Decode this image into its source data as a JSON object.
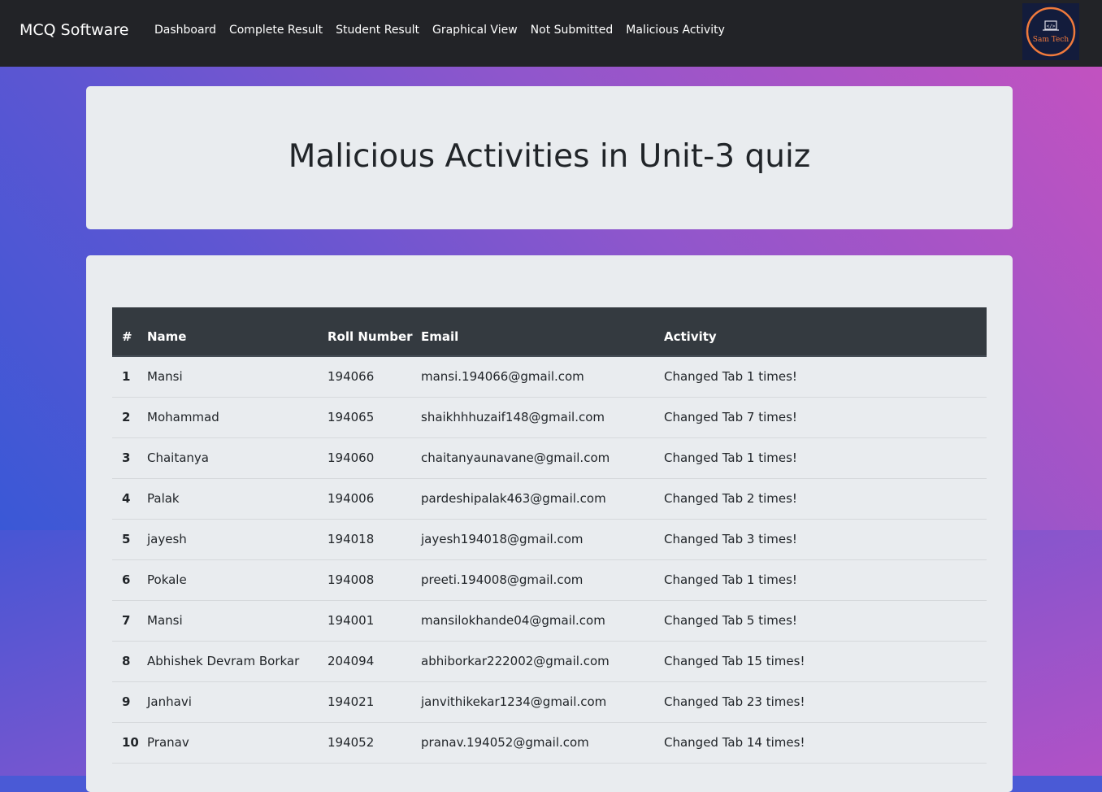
{
  "navbar": {
    "brand": "MCQ Software",
    "links": [
      "Dashboard",
      "Complete Result",
      "Student Result",
      "Graphical View",
      "Not Submitted",
      "Malicious Activity"
    ],
    "logo_text": "Sam Tech"
  },
  "page_title": "Malicious Activities in Unit-3 quiz",
  "table": {
    "headers": [
      "#",
      "Name",
      "Roll Number",
      "Email",
      "Activity"
    ],
    "rows": [
      [
        "1",
        "Mansi",
        "194066",
        "mansi.194066@gmail.com",
        "Changed Tab 1 times!"
      ],
      [
        "2",
        "Mohammad",
        "194065",
        "shaikhhhuzaif148@gmail.com",
        "Changed Tab 7 times!"
      ],
      [
        "3",
        "Chaitanya",
        "194060",
        "chaitanyaunavane@gmail.com",
        "Changed Tab 1 times!"
      ],
      [
        "4",
        "Palak",
        "194006",
        "pardeshipalak463@gmail.com",
        "Changed Tab 2 times!"
      ],
      [
        "5",
        "jayesh",
        "194018",
        "jayesh194018@gmail.com",
        "Changed Tab 3 times!"
      ],
      [
        "6",
        "Pokale",
        "194008",
        "preeti.194008@gmail.com",
        "Changed Tab 1 times!"
      ],
      [
        "7",
        "Mansi",
        "194001",
        "mansilokhande04@gmail.com",
        "Changed Tab 5 times!"
      ],
      [
        "8",
        "Abhishek Devram Borkar",
        "204094",
        "abhiborkar222002@gmail.com",
        "Changed Tab 15 times!"
      ],
      [
        "9",
        "Janhavi",
        "194021",
        "janvithikekar1234@gmail.com",
        "Changed Tab 23 times!"
      ],
      [
        "10",
        "Pranav",
        "194052",
        "pranav.194052@gmail.com",
        "Changed Tab 14 times!"
      ]
    ]
  },
  "colors": {
    "navbar_bg": "#222327",
    "table_header_bg": "#343a40",
    "card_bg": "#e9ecef",
    "gradient_start": "#3a58d6",
    "gradient_end": "#c252c0",
    "logo_ring": "#f07a3c"
  }
}
